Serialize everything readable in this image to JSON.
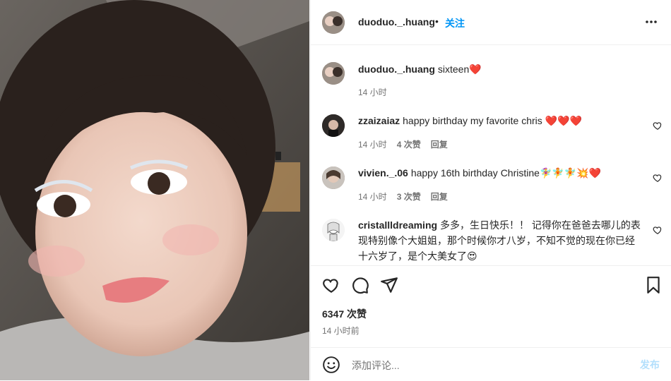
{
  "post": {
    "username": "duoduo._.huang",
    "follow_label": "关注",
    "separator": "•",
    "caption_text": "sixteen",
    "caption_time": "14 小时"
  },
  "comments": [
    {
      "username": "zzaizaiaz",
      "text": "happy birthday my favorite chris",
      "emoji": "❤️❤️❤️",
      "time": "14 小时",
      "likes": "4 次赞",
      "reply": "回复"
    },
    {
      "username": "vivien._.06",
      "text": "happy 16th birthday Christine",
      "emoji": "🧚‍♀️🧚🧚💥❤️",
      "time": "14 小时",
      "likes": "3 次赞",
      "reply": "回复"
    },
    {
      "username": "cristallldreaming",
      "text": "多多，生日快乐！！ 记得你在爸爸去哪儿的表现特别像个大姐姐，那个时候你才八岁，不知不觉的现在你已经十六岁了，是个大美女了",
      "emoji": "😍",
      "time": "",
      "likes": "",
      "reply": ""
    }
  ],
  "caption_emoji": "❤️",
  "stats": {
    "likes": "6347 次赞",
    "time": "14 小时前"
  },
  "comment_box": {
    "placeholder": "添加评论...",
    "post_label": "发布"
  },
  "colors": {
    "accent": "#0095f6",
    "post_disabled": "#b2dffc",
    "heart_red": "#ed4956",
    "muted": "#737373"
  },
  "icons": [
    "more-options-icon",
    "like-icon",
    "comment-icon",
    "share-icon",
    "save-icon",
    "emoji-icon",
    "small-heart-icon"
  ]
}
